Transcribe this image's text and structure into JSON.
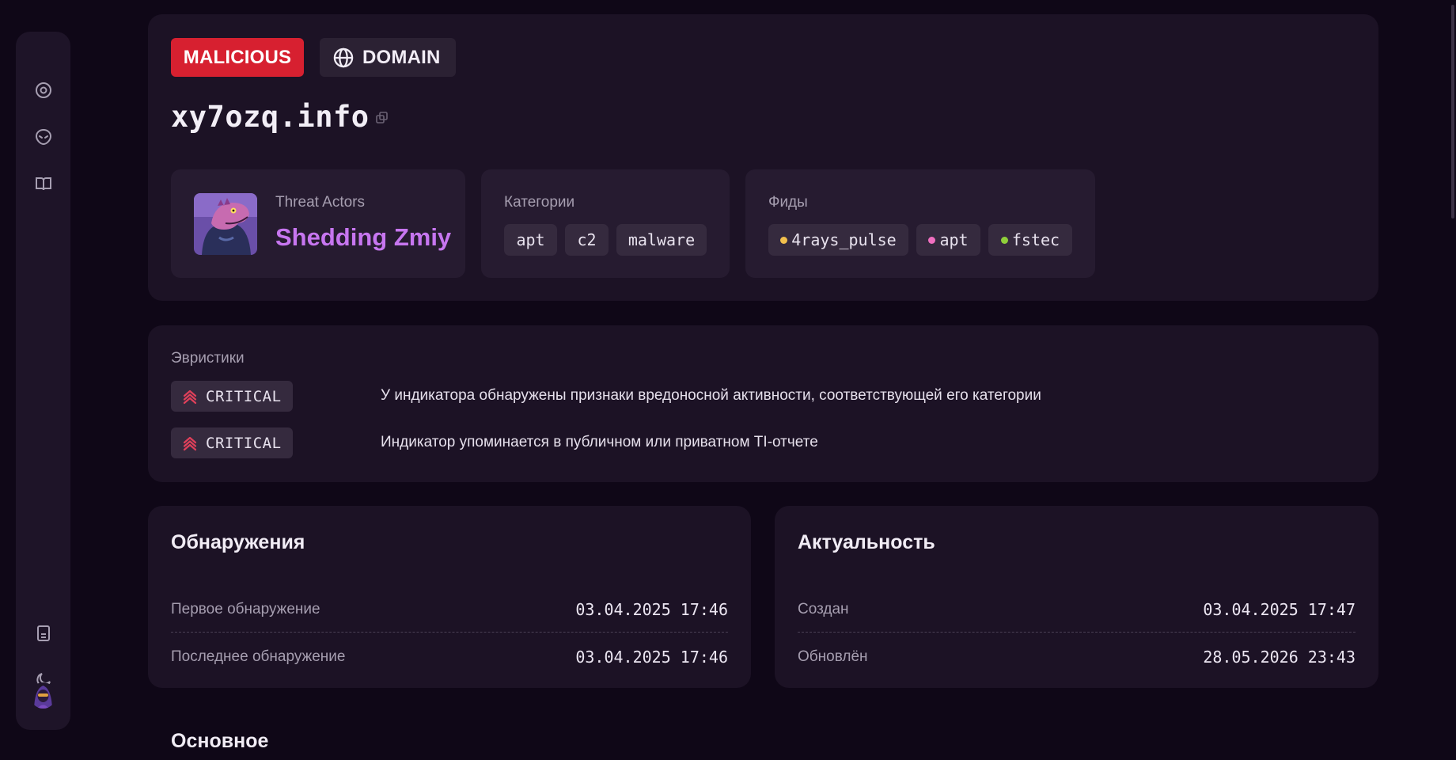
{
  "sidebar": {
    "top_icons": [
      "target-icon",
      "alien-icon",
      "book-icon"
    ],
    "bottom_icons": [
      "document-icon",
      "moon-icon"
    ],
    "avatar": "user-avatar"
  },
  "header": {
    "verdict_badge": "MALICIOUS",
    "type_badge": "DOMAIN",
    "domain": "xy7ozq.info"
  },
  "threat_actors": {
    "label": "Threat Actors",
    "name": "Shedding Zmiy"
  },
  "categories": {
    "label": "Категории",
    "items": [
      "apt",
      "c2",
      "malware"
    ]
  },
  "feeds": {
    "label": "Фиды",
    "items": [
      {
        "name": "4rays_pulse",
        "color": "#f2c04d"
      },
      {
        "name": "apt",
        "color": "#f06fc0"
      },
      {
        "name": "fstec",
        "color": "#8fcf3a"
      }
    ]
  },
  "heuristics": {
    "label": "Эвристики",
    "items": [
      {
        "severity": "CRITICAL",
        "text": "У индикатора обнаружены признаки вредоносной активности, соответствующей его категории"
      },
      {
        "severity": "CRITICAL",
        "text": "Индикатор упоминается в публичном или приватном TI-отчете"
      }
    ]
  },
  "detections": {
    "title": "Обнаружения",
    "rows": [
      {
        "label": "Первое обнаружение",
        "value": "03.04.2025 17:46"
      },
      {
        "label": "Последнее обнаружение",
        "value": "03.04.2025 17:46"
      }
    ]
  },
  "relevance": {
    "title": "Актуальность",
    "rows": [
      {
        "label": "Создан",
        "value": "03.04.2025 17:47"
      },
      {
        "label": "Обновлён",
        "value": "28.05.2026 23:43"
      }
    ]
  },
  "main_section": {
    "title": "Основное"
  },
  "colors": {
    "background": "#0f0717",
    "card": "#1c1225",
    "malicious": "#d72030",
    "actor_name": "#c776f0",
    "critical_icon": "#e0405a"
  }
}
